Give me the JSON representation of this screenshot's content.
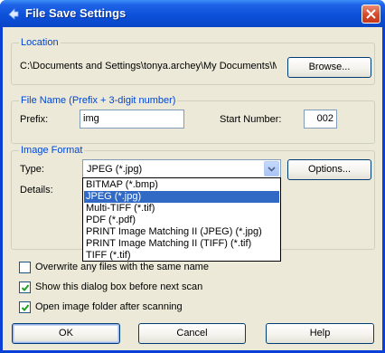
{
  "window": {
    "title": "File Save Settings",
    "app_icon": "scanner-arrow-icon",
    "close_icon": "close-icon"
  },
  "location": {
    "group_label": "Location",
    "path": "C:\\Documents and Settings\\tonya.archey\\My Documents\\M",
    "browse_label": "Browse..."
  },
  "file_name": {
    "group_label": "File Name (Prefix + 3-digit number)",
    "prefix_label": "Prefix:",
    "prefix_value": "img",
    "start_label": "Start Number:",
    "start_value": "002"
  },
  "image_format": {
    "group_label": "Image Format",
    "type_label": "Type:",
    "type_value": "JPEG (*.jpg)",
    "options_label": "Options...",
    "details_label": "Details:",
    "options_list": [
      "BITMAP (*.bmp)",
      "JPEG (*.jpg)",
      "Multi-TIFF (*.tif)",
      "PDF (*.pdf)",
      "PRINT Image Matching II (JPEG) (*.jpg)",
      "PRINT Image Matching II (TIFF) (*.tif)",
      "TIFF (*.tif)"
    ],
    "highlighted_index": 1
  },
  "checkboxes": [
    {
      "label": "Overwrite any files with the same name",
      "checked": false
    },
    {
      "label": "Show this dialog box before next scan",
      "checked": true
    },
    {
      "label": "Open image folder after scanning",
      "checked": true
    }
  ],
  "buttons": {
    "ok": "OK",
    "cancel": "Cancel",
    "help": "Help"
  },
  "colors": {
    "titlebar": "#0b4fd8",
    "dialog_bg": "#ece9d8",
    "group_label": "#0046d5",
    "selection": "#316ac5"
  }
}
